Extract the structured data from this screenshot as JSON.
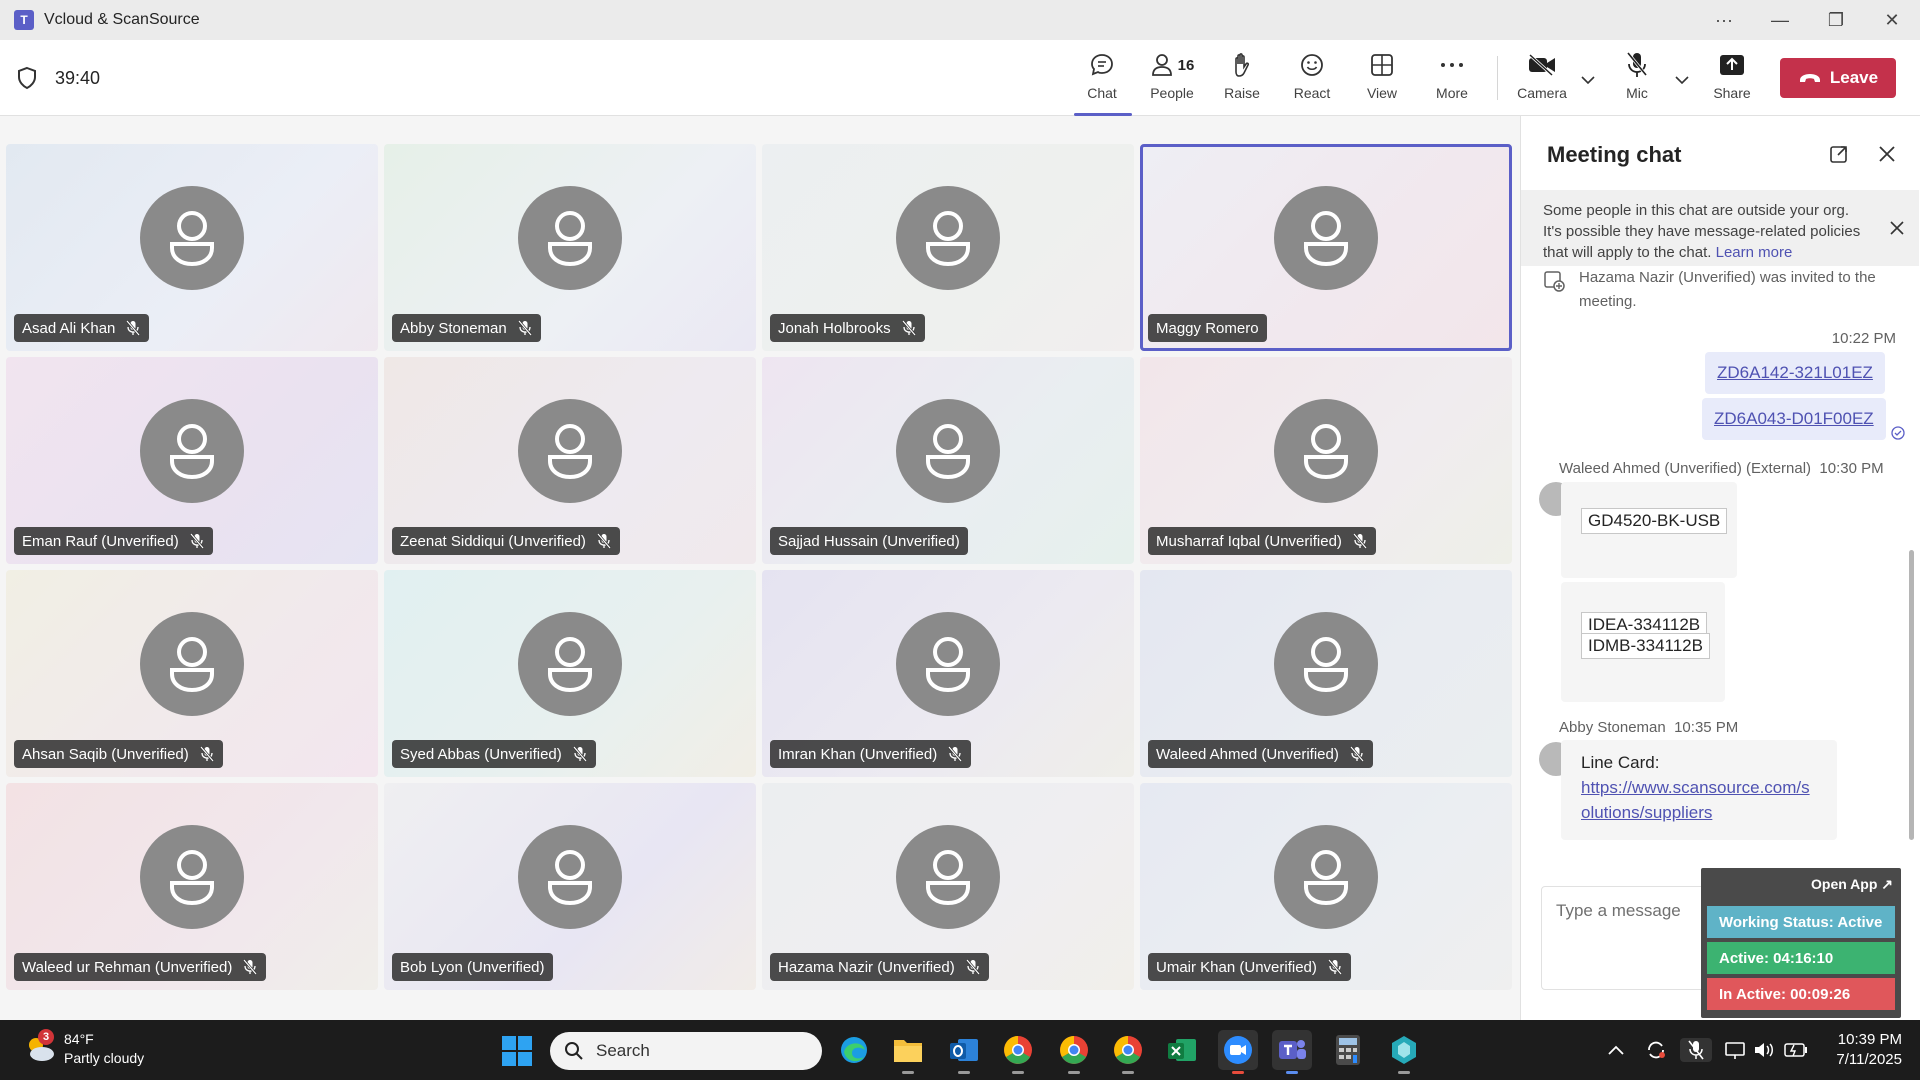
{
  "window": {
    "title": "Vcloud & ScanSource"
  },
  "toolbar": {
    "timer": "39:40",
    "chat_label": "Chat",
    "people_label": "People",
    "people_count": "16",
    "raise_label": "Raise",
    "react_label": "React",
    "view_label": "View",
    "more_label": "More",
    "camera_label": "Camera",
    "mic_label": "Mic",
    "share_label": "Share",
    "leave_label": "Leave"
  },
  "participants": [
    "Asad Ali Khan",
    "Abby Stoneman",
    "Jonah Holbrooks",
    "Maggy Romero",
    "Eman Rauf (Unverified)",
    "Zeenat Siddiqui (Unverified)",
    "Sajjad Hussain (Unverified)",
    "Musharraf Iqbal (Unverified)",
    "Ahsan Saqib (Unverified)",
    "Syed Abbas (Unverified)",
    "Imran Khan (Unverified)",
    "Waleed Ahmed (Unverified)",
    "Waleed ur Rehman (Unverified)",
    "Bob Lyon (Unverified)",
    "Hazama Nazir (Unverified)",
    "Umair Khan (Unverified)"
  ],
  "chat": {
    "title": "Meeting chat",
    "notice_text": "Some people in this chat are outside your org. It's possible they have message-related policies that will apply to the chat.",
    "notice_link": "Learn more",
    "system_message": "Hazama Nazir (Unverified) was invited to the meeting.",
    "my_time": "10:22 PM",
    "my_link_1": "ZD6A142-321L01EZ",
    "my_link_2": "ZD6A043-D01F00EZ",
    "waleed_sender": "Waleed Ahmed (Unverified) (External)",
    "waleed_time": "10:30 PM",
    "waleed_msg_1": "GD4520-BK-USB",
    "waleed_msg_2a": "IDEA-334112B",
    "waleed_msg_2b": "IDMB-334112B",
    "abby_sender": "Abby Stoneman",
    "abby_time": "10:35 PM",
    "abby_msg_label": "Line Card:",
    "abby_msg_link": "https://www.scansource.com/solutions/suppliers",
    "abby_msg_link_1": "https://www.scansource.com/s",
    "abby_msg_link_2": "olutions/suppliers",
    "compose_placeholder": "Type a message"
  },
  "widget": {
    "open_app": "Open App ↗",
    "working_status": "Working Status: Active",
    "active": "Active: 04:16:10",
    "inactive": "In Active: 00:09:26"
  },
  "taskbar": {
    "weather_temp": "84°F",
    "weather_desc": "Partly cloudy",
    "weather_badge": "3",
    "search_placeholder": "Search",
    "time": "10:39 PM",
    "date": "7/11/2025"
  },
  "colors": {
    "accent": "#5b5fc7",
    "leave": "#c4314b",
    "status_active": "#3cb371",
    "status_inactive": "#e0575b",
    "status_working": "#5fb3c7"
  }
}
